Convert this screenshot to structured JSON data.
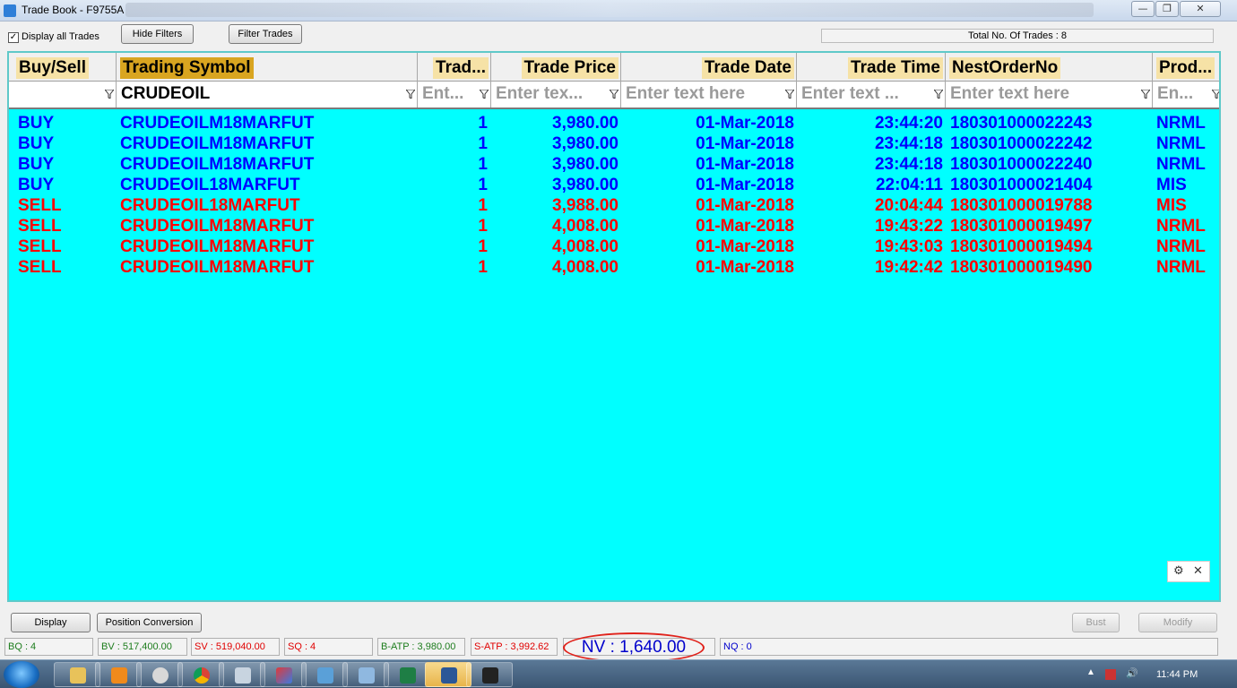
{
  "window": {
    "title": "Trade Book - F9755A",
    "min": "—",
    "max": "❐",
    "close": "✕"
  },
  "toolbar": {
    "display_all_label": "Display all Trades",
    "display_all_checked": "✓",
    "hide_filters": "Hide Filters",
    "filter_trades": "Filter Trades",
    "total_trades": "Total No. Of Trades : 8"
  },
  "grid": {
    "columns": [
      "Buy/Sell",
      "Trading Symbol",
      "Trad...",
      "Trade Price",
      "Trade Date",
      "Trade Time",
      "NestOrderNo",
      "Prod..."
    ],
    "filters": [
      "",
      "CRUDEOIL",
      "Ent...",
      "Enter tex...",
      "Enter text here",
      "Enter text ...",
      "Enter text here",
      "En..."
    ],
    "rows": [
      {
        "side": "BUY",
        "symbol": "CRUDEOILM18MARFUT",
        "qty": "1",
        "price": "3,980.00",
        "date": "01-Mar-2018",
        "time": "23:44:20",
        "order": "180301000022243",
        "prod": "NRML"
      },
      {
        "side": "BUY",
        "symbol": "CRUDEOILM18MARFUT",
        "qty": "1",
        "price": "3,980.00",
        "date": "01-Mar-2018",
        "time": "23:44:18",
        "order": "180301000022242",
        "prod": "NRML"
      },
      {
        "side": "BUY",
        "symbol": "CRUDEOILM18MARFUT",
        "qty": "1",
        "price": "3,980.00",
        "date": "01-Mar-2018",
        "time": "23:44:18",
        "order": "180301000022240",
        "prod": "NRML"
      },
      {
        "side": "BUY",
        "symbol": "CRUDEOIL18MARFUT",
        "qty": "1",
        "price": "3,980.00",
        "date": "01-Mar-2018",
        "time": "22:04:11",
        "order": "180301000021404",
        "prod": "MIS"
      },
      {
        "side": "SELL",
        "symbol": "CRUDEOIL18MARFUT",
        "qty": "1",
        "price": "3,988.00",
        "date": "01-Mar-2018",
        "time": "20:04:44",
        "order": "180301000019788",
        "prod": "MIS"
      },
      {
        "side": "SELL",
        "symbol": "CRUDEOILM18MARFUT",
        "qty": "1",
        "price": "4,008.00",
        "date": "01-Mar-2018",
        "time": "19:43:22",
        "order": "180301000019497",
        "prod": "NRML"
      },
      {
        "side": "SELL",
        "symbol": "CRUDEOILM18MARFUT",
        "qty": "1",
        "price": "4,008.00",
        "date": "01-Mar-2018",
        "time": "19:43:03",
        "order": "180301000019494",
        "prod": "NRML"
      },
      {
        "side": "SELL",
        "symbol": "CRUDEOILM18MARFUT",
        "qty": "1",
        "price": "4,008.00",
        "date": "01-Mar-2018",
        "time": "19:42:42",
        "order": "180301000019490",
        "prod": "NRML"
      }
    ],
    "gear": "⚙",
    "close": "✕"
  },
  "actions": {
    "display": "Display",
    "position_conversion": "Position Conversion",
    "bust": "Bust",
    "modify": "Modify"
  },
  "status": {
    "bq": "BQ : 4",
    "bv": "BV : 517,400.00",
    "sv": "SV : 519,040.00",
    "sq": "SQ : 4",
    "batp": "B-ATP : 3,980.00",
    "satp": "S-ATP : 3,992.62",
    "nv": "NV : 1,640.00",
    "nq": "NQ : 0"
  },
  "taskbar": {
    "clock": "11:44 PM"
  },
  "colors": {
    "grid_bg": "#00ffff",
    "buy": "#0000ff",
    "sell": "#ff0000",
    "header_highlight": "#f6e2a6",
    "sorted_header": "#d9a520"
  }
}
